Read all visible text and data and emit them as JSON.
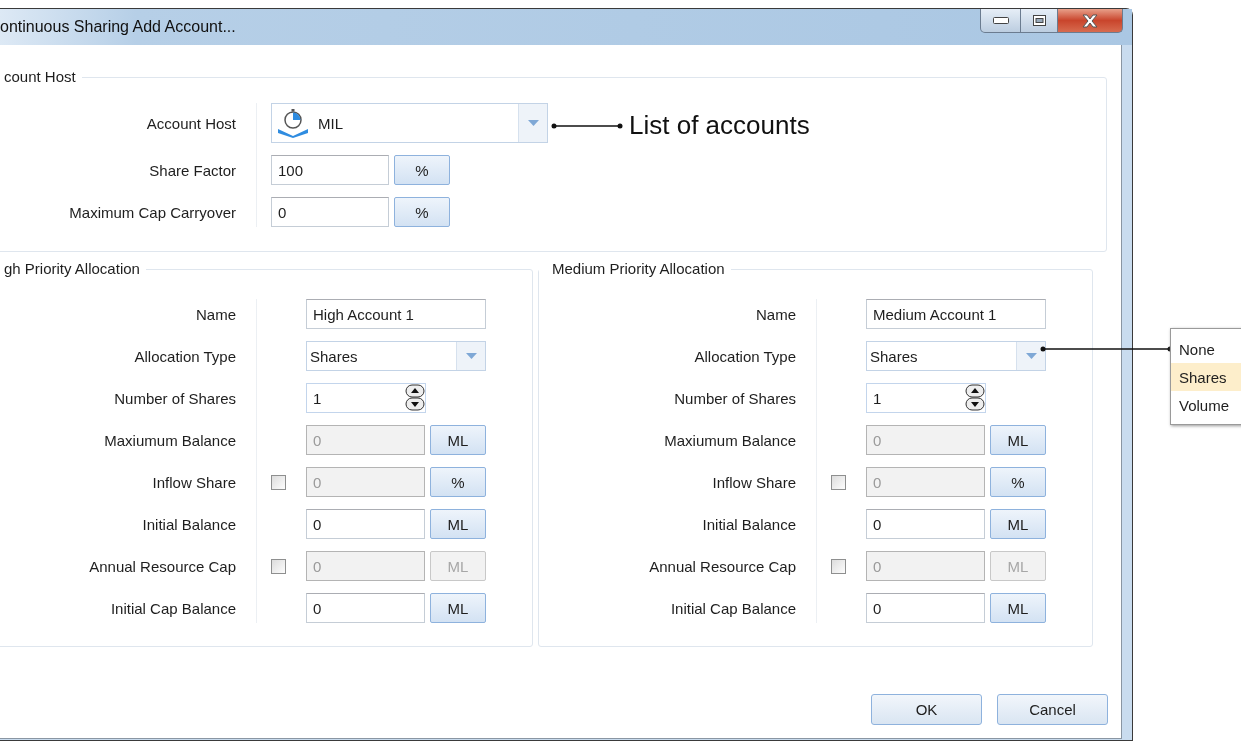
{
  "window": {
    "title": "ontinuous Sharing Add Account..."
  },
  "account_host_group": {
    "title": "count Host",
    "rows": [
      {
        "kind": "combo",
        "label": "Account Host",
        "value": "MIL"
      },
      {
        "kind": "unit",
        "label": "Share Factor",
        "value": "100",
        "unit": "%",
        "disabled": false,
        "unit_disabled": false
      },
      {
        "kind": "unit",
        "label": "Maximum Cap Carryover",
        "value": "0",
        "unit": "%",
        "disabled": false,
        "unit_disabled": false
      }
    ]
  },
  "allocations": [
    {
      "title": "gh Priority Allocation",
      "rows": [
        {
          "kind": "text",
          "label": "Name",
          "value": "High Account 1"
        },
        {
          "kind": "combo",
          "label": "Allocation Type",
          "value": "Shares"
        },
        {
          "kind": "spin",
          "label": "Number of Shares",
          "value": "1"
        },
        {
          "kind": "unit",
          "label": "Maxiumum Balance",
          "value": "0",
          "unit": "ML",
          "disabled": true,
          "unit_disabled": false
        },
        {
          "kind": "unit",
          "label": "Inflow Share",
          "value": "0",
          "unit": "%",
          "disabled": true,
          "unit_disabled": false,
          "checked": false
        },
        {
          "kind": "unit",
          "label": "Initial Balance",
          "value": "0",
          "unit": "ML",
          "disabled": false,
          "unit_disabled": false
        },
        {
          "kind": "unit",
          "label": "Annual Resource Cap",
          "value": "0",
          "unit": "ML",
          "disabled": true,
          "unit_disabled": true,
          "checked": false
        },
        {
          "kind": "unit",
          "label": "Initial Cap Balance",
          "value": "0",
          "unit": "ML",
          "disabled": false,
          "unit_disabled": false
        }
      ]
    },
    {
      "title": "Medium Priority Allocation",
      "rows": [
        {
          "kind": "text",
          "label": "Name",
          "value": "Medium Account 1"
        },
        {
          "kind": "combo",
          "label": "Allocation Type",
          "value": "Shares"
        },
        {
          "kind": "spin",
          "label": "Number of Shares",
          "value": "1"
        },
        {
          "kind": "unit",
          "label": "Maxiumum Balance",
          "value": "0",
          "unit": "ML",
          "disabled": true,
          "unit_disabled": false
        },
        {
          "kind": "unit",
          "label": "Inflow Share",
          "value": "0",
          "unit": "%",
          "disabled": true,
          "unit_disabled": false,
          "checked": false
        },
        {
          "kind": "unit",
          "label": "Initial Balance",
          "value": "0",
          "unit": "ML",
          "disabled": false,
          "unit_disabled": false
        },
        {
          "kind": "unit",
          "label": "Annual Resource Cap",
          "value": "0",
          "unit": "ML",
          "disabled": true,
          "unit_disabled": true,
          "checked": false
        },
        {
          "kind": "unit",
          "label": "Initial Cap Balance",
          "value": "0",
          "unit": "ML",
          "disabled": false,
          "unit_disabled": false
        }
      ]
    }
  ],
  "buttons": [
    {
      "label": "OK"
    },
    {
      "label": "Cancel"
    }
  ],
  "callout": {
    "text": "List of accounts"
  },
  "dropdown_list": {
    "items": [
      {
        "label": "None",
        "selected": false
      },
      {
        "label": "Shares",
        "selected": true
      },
      {
        "label": "Volume",
        "selected": false
      }
    ]
  }
}
